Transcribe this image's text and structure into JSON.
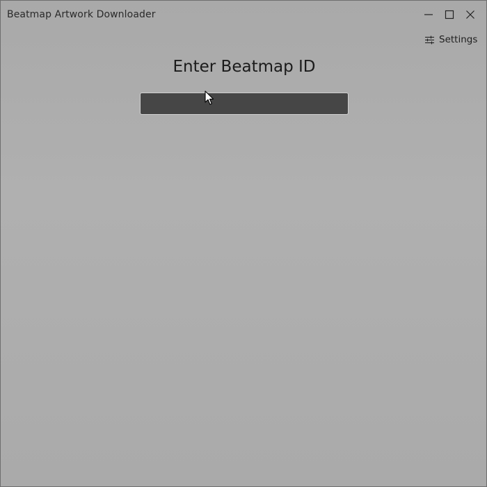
{
  "window": {
    "title": "Beatmap Artwork Downloader",
    "controls": {
      "minimize_icon": "minimize-icon",
      "maximize_icon": "maximize-icon",
      "close_icon": "close-icon"
    }
  },
  "toolbar": {
    "settings_label": "Settings",
    "settings_icon": "sliders-icon"
  },
  "main": {
    "heading": "Enter Beatmap ID",
    "beatmap_input": {
      "value": "",
      "placeholder": ""
    }
  },
  "colors": {
    "background": "#adadad",
    "input_background": "#464646",
    "input_border": "#d0d0d0",
    "text": "#1b1b1b"
  }
}
